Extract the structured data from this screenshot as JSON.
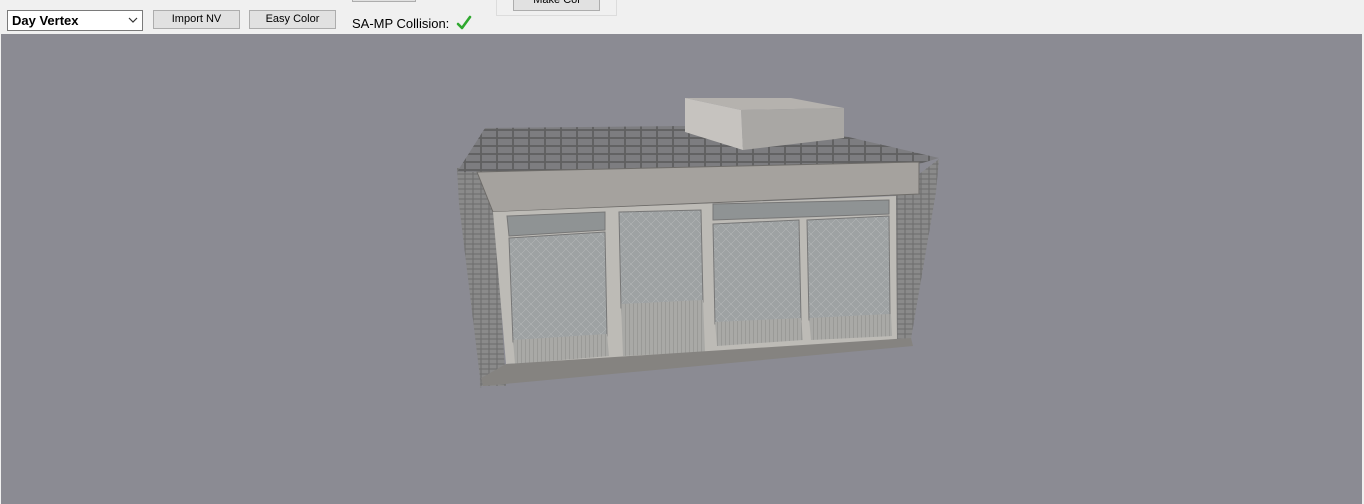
{
  "toolbar": {
    "mode_select_value": "Day Vertex",
    "import_nv_label": "Import NV",
    "easy_color_label": "Easy Color",
    "make_col_label": "Make Col",
    "collision_label": "SA-MP Collision:",
    "collision_status_icon": "checkmark-icon"
  },
  "viewport": {
    "background_color": "#8b8b93",
    "model_description_icon": "3d-building-model"
  }
}
